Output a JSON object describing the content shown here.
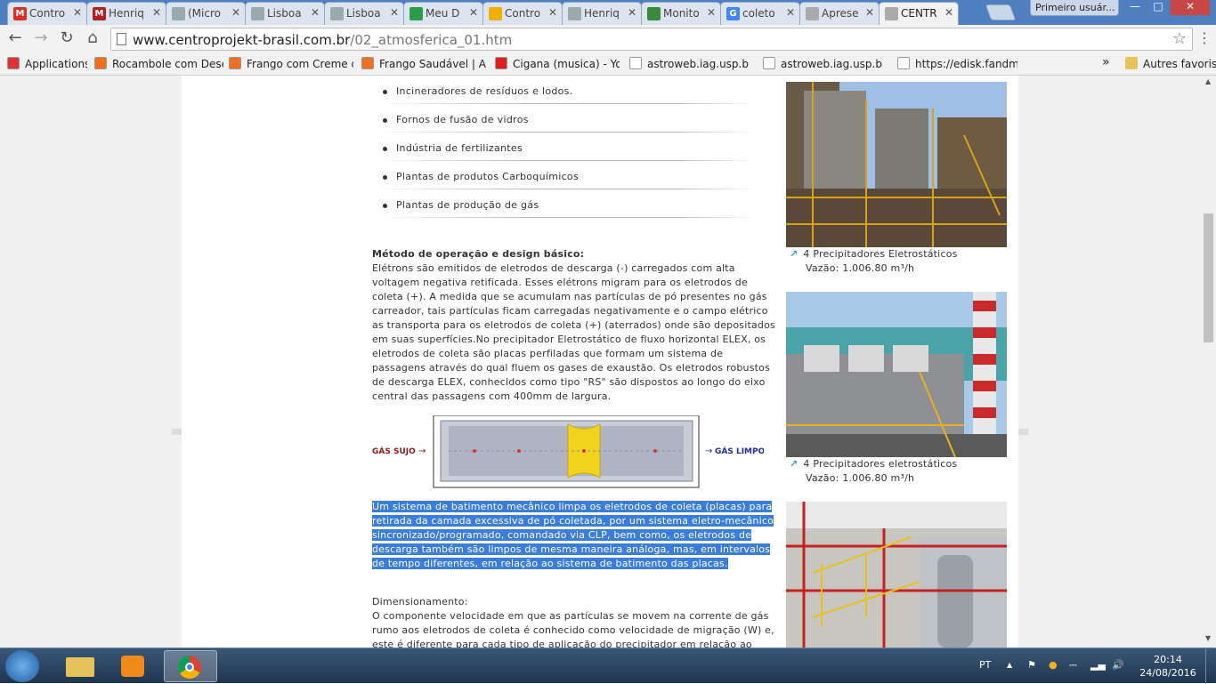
{
  "tabs": [
    {
      "label": "Contro",
      "icon": "gmail-icon",
      "color": "#d93025",
      "glyph": "M"
    },
    {
      "label": "Henriq",
      "icon": "app-icon",
      "color": "#b02020",
      "glyph": "M"
    },
    {
      "label": "(Micro",
      "icon": "page-icon",
      "color": "#9aa",
      "glyph": ""
    },
    {
      "label": "Lisboa",
      "icon": "page-icon",
      "color": "#9aa",
      "glyph": ""
    },
    {
      "label": "Lisboa",
      "icon": "page-icon",
      "color": "#9aa",
      "glyph": ""
    },
    {
      "label": "Meu D",
      "icon": "drive-icon",
      "color": "#2a9d4a",
      "glyph": ""
    },
    {
      "label": "Contro",
      "icon": "mail-icon",
      "color": "#f0b000",
      "glyph": ""
    },
    {
      "label": "Henriq",
      "icon": "page-icon",
      "color": "#9aa",
      "glyph": ""
    },
    {
      "label": "Monito",
      "icon": "flag-icon",
      "color": "#3a8a3a",
      "glyph": ""
    },
    {
      "label": "coleto",
      "icon": "google-icon",
      "color": "#4285f4",
      "glyph": "G"
    },
    {
      "label": "Aprese",
      "icon": "doc-icon",
      "color": "#aaa",
      "glyph": ""
    },
    {
      "label": "CENTR",
      "icon": "doc-icon",
      "color": "#aaa",
      "glyph": ""
    }
  ],
  "user_button": "Primeiro usuár...",
  "url_host": "www.centroprojekt-brasil.com.br",
  "url_path": "/02_atmosferica_01.htm",
  "bookmarks": [
    {
      "label": "Applications",
      "color": "#d33"
    },
    {
      "label": "Rocambole com Dese",
      "color": "#f07020"
    },
    {
      "label": "Frango com Creme de",
      "color": "#f07020"
    },
    {
      "label": "Frango Saudável | Ave",
      "color": "#f07020"
    },
    {
      "label": "Cigana (musica) - You",
      "color": "#e02020"
    },
    {
      "label": "astroweb.iag.usp.br/~",
      "color": "#fff"
    },
    {
      "label": "astroweb.iag.usp.br/~",
      "color": "#fff"
    },
    {
      "label": "https://edisk.fandm.e",
      "color": "#fff"
    }
  ],
  "bookmarks_more": "»",
  "other_bookmarks": "Autres favoris",
  "list_items": [
    "Incineradores de resíduos e lodos.",
    "Fornos de fusão de vidros",
    "Indústria de fertilizantes",
    "Plantas de produtos Carboquímicos",
    "Plantas de produção de gás"
  ],
  "method_heading": "Método de operação e design básico:",
  "method_text": "Elétrons são emitidos de eletrodos de descarga (-) carregados com alta voltagem negativa retificada. Esses elétrons migram para os eletrodos de coleta (+). A medida que se acumulam nas partículas de pó presentes no gás carreador, tais partículas ficam carregadas negativamente e o campo elétrico as transporta para os eletrodos de coleta (+) (aterrados) onde são depositados em suas superfícies.No precipitador Eletrostático de fluxo horizontal ELEX, os eletrodos de coleta são placas perfiladas que formam um sistema de passagens através do qual fluem os gases de exaustão. Os eletrodos robustos de descarga ELEX, conhecidos como tipo \"RS\" são dispostos ao longo do eixo central das passagens com 400mm de largura.",
  "diagram": {
    "left_label": "GÁS SUJO",
    "right_label": "GÁS LIMPO"
  },
  "highlighted_text": "Um sistema de batimento mecânico limpa os eletrodos de coleta (placas) para retirada da camada excessiva de pó coletada, por um sistema eletro-mecânico sincronizado/programado, comandado via CLP, bem como, os eletrodos de descarga também são limpos de mesma maneira análoga, mas, em intervalos de tempo diferentes, em relação ao sistema de batimento das placas.",
  "sizing_heading": "Dimensionamento:",
  "sizing_text": "O componente velocidade em que as partículas se movem na corrente de gás rumo aos eletrodos de coleta é conhecido como velocidade de migração (W) e, este é diferente para cada tipo de aplicação do precipitador em relação ao",
  "photos": [
    {
      "caption": "4 Precipitadores Eletrostáticos",
      "flow": "Vazão: 1.006.80 m³/h"
    },
    {
      "caption": "4 Precipitadores eletrostáticos",
      "flow": "Vazão: 1.006.80 m³/h"
    }
  ],
  "tray": {
    "lang": "PT",
    "time": "20:14",
    "date": "24/08/2016"
  }
}
